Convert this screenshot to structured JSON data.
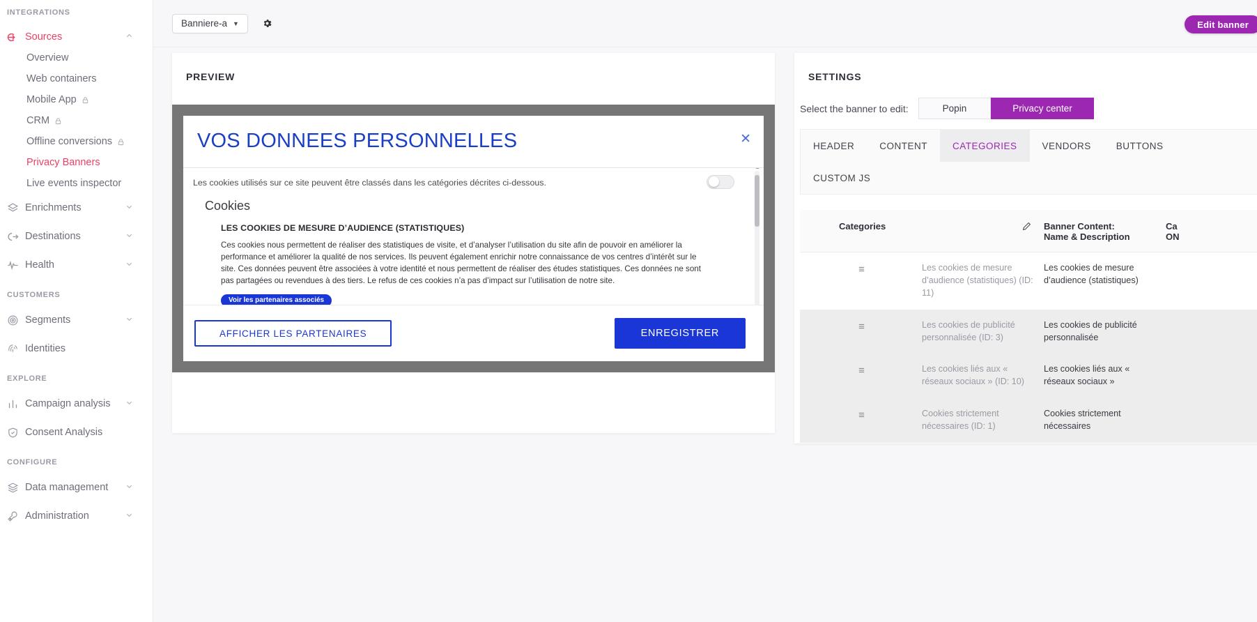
{
  "sidebar": {
    "sections": [
      {
        "label": "INTEGRATIONS",
        "items": [
          {
            "label": "Sources",
            "icon": "login-arrow-icon",
            "active": true,
            "caret": "up",
            "children": [
              {
                "label": "Overview",
                "lock": false,
                "current": false
              },
              {
                "label": "Web containers",
                "lock": false,
                "current": false
              },
              {
                "label": "Mobile App",
                "lock": true,
                "current": false
              },
              {
                "label": "CRM",
                "lock": true,
                "current": false
              },
              {
                "label": "Offline conversions",
                "lock": true,
                "current": false
              },
              {
                "label": "Privacy Banners",
                "lock": false,
                "current": true
              },
              {
                "label": "Live events inspector",
                "lock": false,
                "current": false
              }
            ]
          },
          {
            "label": "Enrichments",
            "icon": "layers-star-icon",
            "active": false,
            "caret": "down",
            "children": []
          },
          {
            "label": "Destinations",
            "icon": "logout-arrow-icon",
            "active": false,
            "caret": "down",
            "children": []
          },
          {
            "label": "Health",
            "icon": "pulse-icon",
            "active": false,
            "caret": "down",
            "children": []
          }
        ]
      },
      {
        "label": "CUSTOMERS",
        "items": [
          {
            "label": "Segments",
            "icon": "target-icon",
            "active": false,
            "caret": "down",
            "children": []
          },
          {
            "label": "Identities",
            "icon": "fingerprint-icon",
            "active": false,
            "caret": "",
            "children": []
          }
        ]
      },
      {
        "label": "EXPLORE",
        "items": [
          {
            "label": "Campaign analysis",
            "icon": "bar-chart-icon",
            "active": false,
            "caret": "down",
            "children": []
          },
          {
            "label": "Consent Analysis",
            "icon": "shield-check-icon",
            "active": false,
            "caret": "",
            "children": []
          }
        ]
      },
      {
        "label": "CONFIGURE",
        "items": [
          {
            "label": "Data management",
            "icon": "stack-icon",
            "active": false,
            "caret": "down",
            "children": []
          },
          {
            "label": "Administration",
            "icon": "wrench-icon",
            "active": false,
            "caret": "down",
            "children": []
          }
        ]
      }
    ]
  },
  "topbar": {
    "banner_select_label": "Banniere-a",
    "gear_icon": "gear-icon",
    "edit_banner_label": "Edit banner"
  },
  "preview": {
    "panel_title": "PREVIEW",
    "banner": {
      "title": "VOS DONNEES PERSONNELLES",
      "close_icon": "close-icon",
      "intro": "Les cookies utilisés sur ce site peuvent être classés dans les catégories décrites ci-dessous.",
      "section_heading": "Cookies",
      "category_title": "LES COOKIES DE MESURE D’AUDIENCE (STATISTIQUES)",
      "category_paragraph": "Ces cookies nous permettent de réaliser des statistiques de visite, et d’analyser l’utilisation du site afin de pouvoir en améliorer la performance et améliorer la qualité de nos services. Ils peuvent également enrichir notre connaissance de vos centres d’intérêt sur le site. Ces données peuvent être associées à votre identité et nous permettent de réaliser des études statistiques. Ces données ne sont pas partagées ou revendues à des tiers. Le refus de ces cookies n’a pas d’impact sur l’utilisation de notre site.",
      "partners_button": "Voir les partenaires associés",
      "toggle_state": "off",
      "secondary_button": "AFFICHER LES PARTENAIRES",
      "primary_button": "ENREGISTRER"
    }
  },
  "settings": {
    "panel_title": "SETTINGS",
    "select_label": "Select the banner to edit:",
    "banner_options": [
      {
        "label": "Popin",
        "selected": false
      },
      {
        "label": "Privacy center",
        "selected": true
      }
    ],
    "tabs": [
      {
        "label": "HEADER",
        "active": false
      },
      {
        "label": "CONTENT",
        "active": false
      },
      {
        "label": "CATEGORIES",
        "active": true
      },
      {
        "label": "VENDORS",
        "active": false
      },
      {
        "label": "BUTTONS",
        "active": false
      },
      {
        "label": "CUSTOM JS",
        "active": false
      }
    ],
    "table": {
      "columns": [
        {
          "label": "Categories",
          "icon": "pencil-icon"
        },
        {
          "label": "Banner Content:\nName & Description"
        },
        {
          "label": "Ca\nON"
        }
      ],
      "col0": "Categories",
      "col1_line1": "Banner Content:",
      "col1_line2": "Name & Description",
      "col2_line1": "Ca",
      "col2_line2": "ON",
      "rows": [
        {
          "drag_icon": "drag-handle-icon",
          "category": "Les cookies de mesure d’audience (statistiques) (ID: 11)",
          "banner_content": "Les cookies de mesure d’audience (statistiques)"
        },
        {
          "drag_icon": "drag-handle-icon",
          "category": "Les cookies de publicité personnalisée (ID: 3)",
          "banner_content": "Les cookies de publicité personnalisée"
        },
        {
          "drag_icon": "drag-handle-icon",
          "category": "Les cookies liés aux « réseaux sociaux » (ID: 10)",
          "banner_content": "Les cookies liés aux « réseaux sociaux »"
        },
        {
          "drag_icon": "drag-handle-icon",
          "category": "Cookies strictement nécessaires (ID: 1)",
          "banner_content": "Cookies strictement nécessaires"
        }
      ]
    }
  },
  "colors": {
    "accent_pink": "#ef3e64",
    "accent_purple": "#9c27b0",
    "banner_blue": "#1a36d6",
    "stage_gray": "#767676"
  }
}
